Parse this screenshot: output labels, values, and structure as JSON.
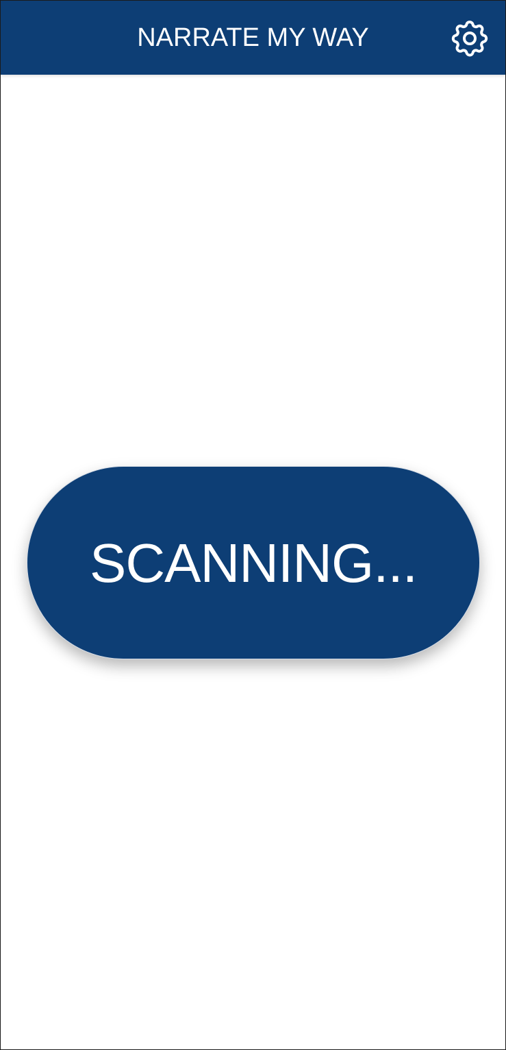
{
  "header": {
    "title": "NARRATE MY WAY",
    "settings_icon": "gear-icon"
  },
  "main": {
    "scan_button_label": "SCANNING..."
  },
  "colors": {
    "primary": "#0d3e75",
    "background": "#ffffff",
    "text_on_primary": "#ffffff"
  }
}
